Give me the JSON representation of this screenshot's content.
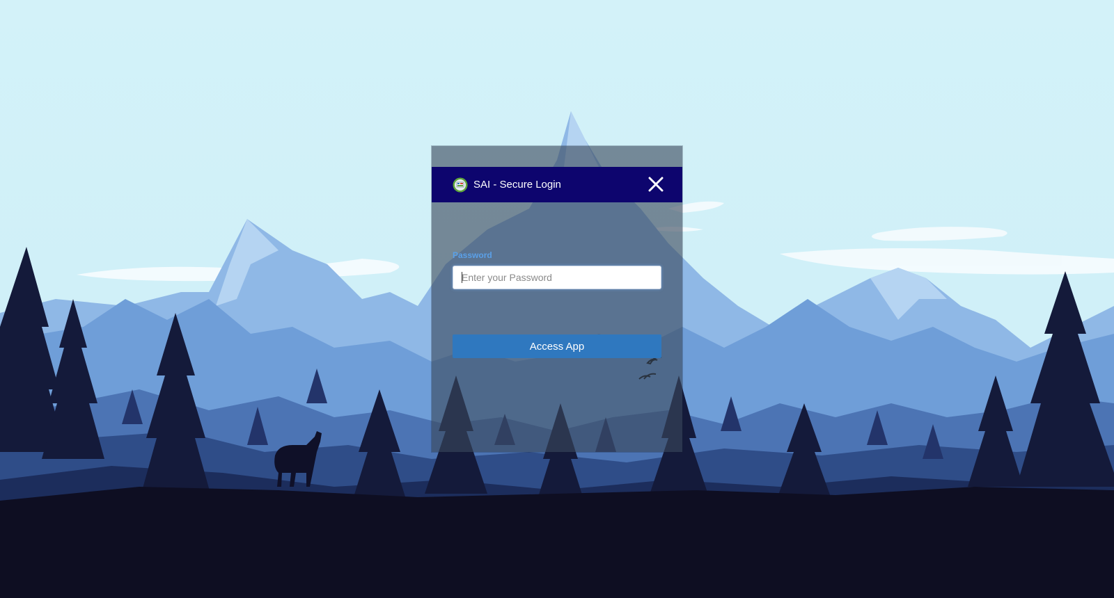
{
  "login": {
    "title": "SAI - Secure Login",
    "logo_icon": "emblem-logo-icon",
    "close_icon": "close-icon",
    "password_label": "Password",
    "password_placeholder": "Enter your Password",
    "password_value": "",
    "submit_label": "Access App"
  },
  "colors": {
    "header_bg": "#0d056e",
    "label": "#5aa0e8",
    "button_bg": "#2f78bf",
    "sky": "#d0f0f8",
    "ground": "#0e0e22"
  }
}
